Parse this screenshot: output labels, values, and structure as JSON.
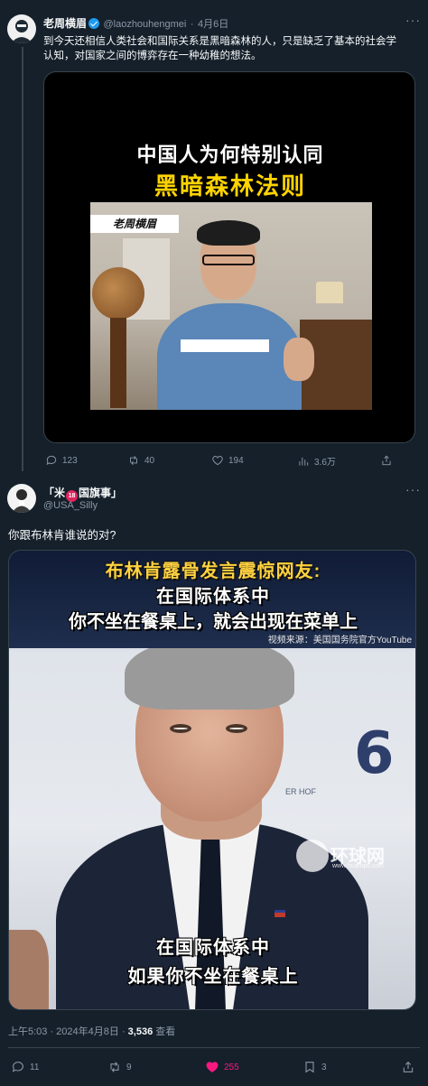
{
  "post1": {
    "display_name": "老周横眉",
    "handle": "@laozhouhengmei",
    "separator": "·",
    "date": "4月6日",
    "text_line1": "到今天还相信人类社会和国际关系是黑暗森林的人，只是缺乏了基本的社会学",
    "text_line2": "认知，对国家之间的博弈存在一种幼稚的想法。",
    "video": {
      "title_line1": "中国人为何特别认同",
      "title_line2": "黑暗森林法则",
      "logo_text": "老周横眉"
    },
    "actions": {
      "replies": "123",
      "retweets": "40",
      "likes": "194",
      "views": "3.6万"
    }
  },
  "post2": {
    "display_name_left": "「米",
    "badge": "18",
    "display_name_right": "国旗事」",
    "handle": "@USA_Silly",
    "text": "你跟布林肯谁说的对?",
    "image": {
      "headline_line1": "布林肯露骨发言震惊网友:",
      "headline_line2": "在国际体系中",
      "headline_line3": "你不坐在餐桌上，就会出现在菜单上",
      "source": "视频来源：美国国务院官方YouTube",
      "watermark_main": "环球网",
      "watermark_url": "www.huanqiu.com",
      "subtitle_line1": "在国际体系中",
      "subtitle_line2": "如果你不坐在餐桌上",
      "bg_text": "ER HOF"
    },
    "timestamp": "上午5:03 · 2024年4月8日 · ",
    "views_count": "3,536",
    "views_label": " 查看",
    "actions": {
      "replies": "11",
      "retweets": "9",
      "likes": "255",
      "bookmarks": "3"
    }
  },
  "colors": {
    "background": "#15202b",
    "border": "#38444d",
    "muted": "#8b98a5",
    "like_active": "#f91880",
    "verified": "#1d9bf0"
  }
}
